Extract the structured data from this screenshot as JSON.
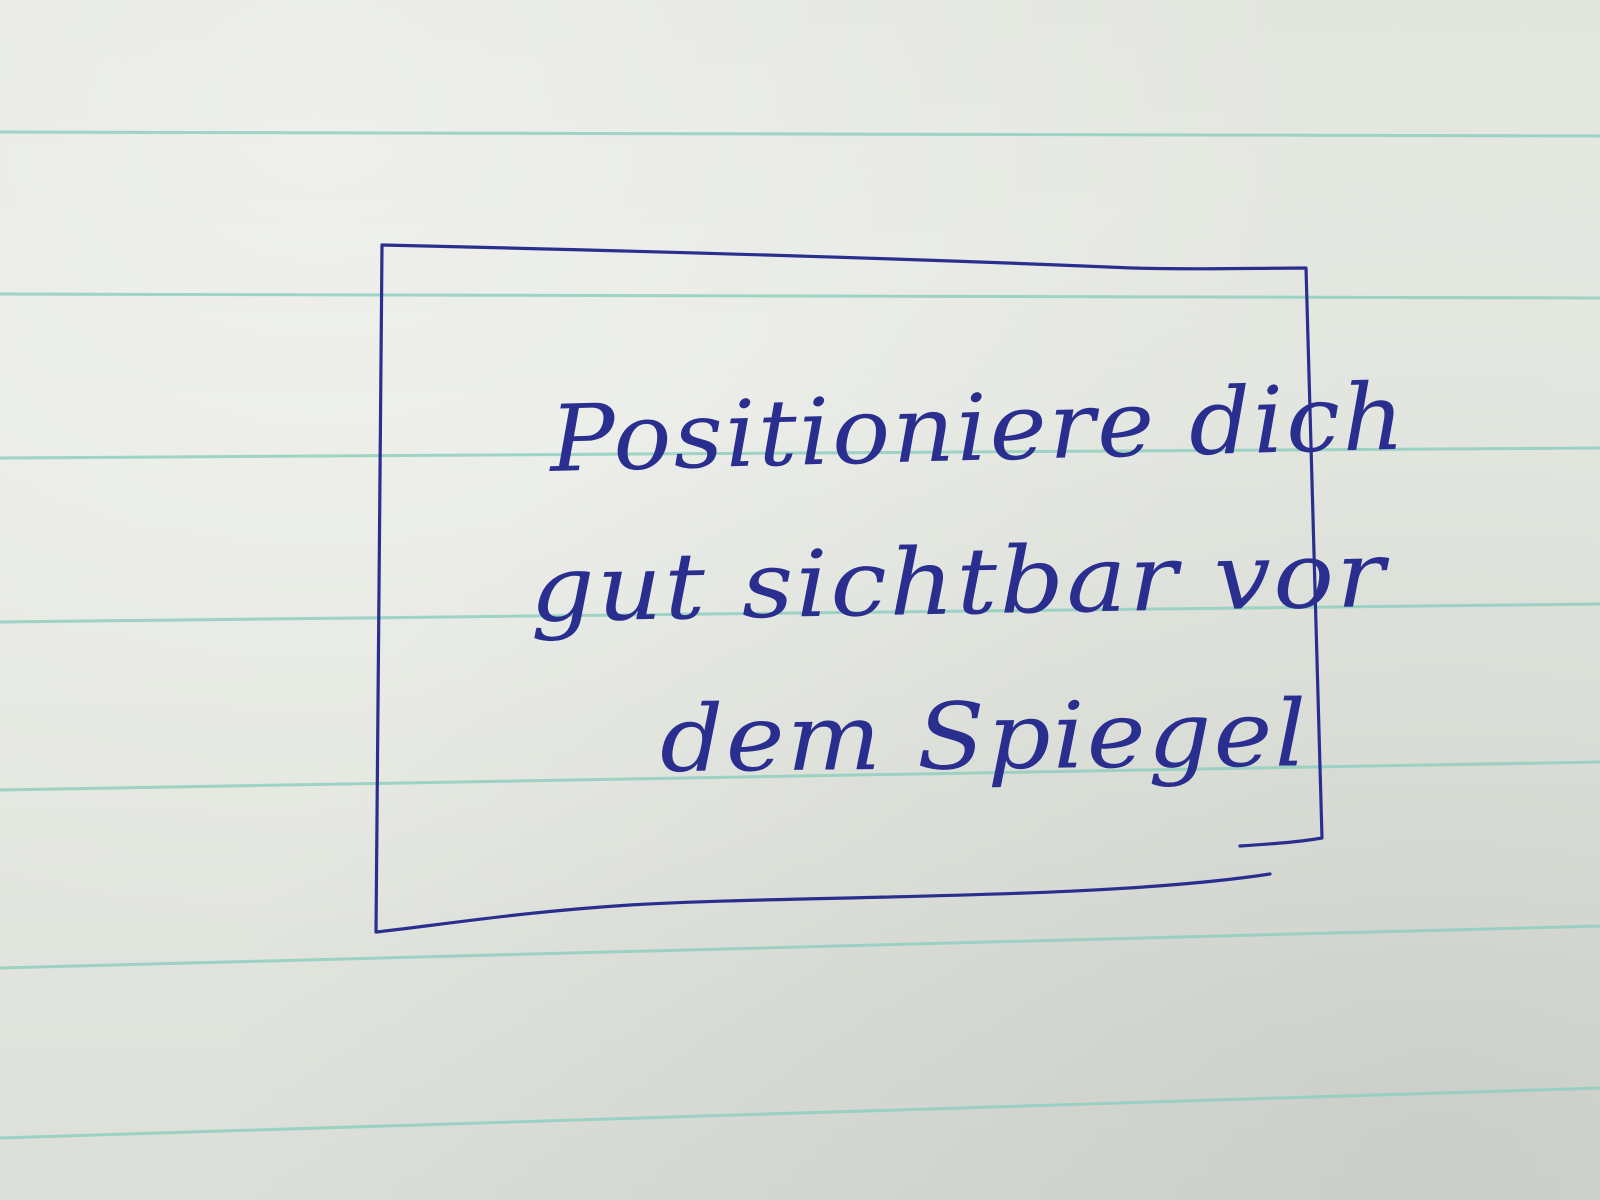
{
  "handwritten_note": {
    "lines": [
      "Positioniere dich",
      "gut sichtbar vor",
      "dem Spiegel"
    ]
  },
  "colors": {
    "paper": "#e6e8e2",
    "ruled_line": "#8fcfbe",
    "ink": "#2a2f8f"
  }
}
